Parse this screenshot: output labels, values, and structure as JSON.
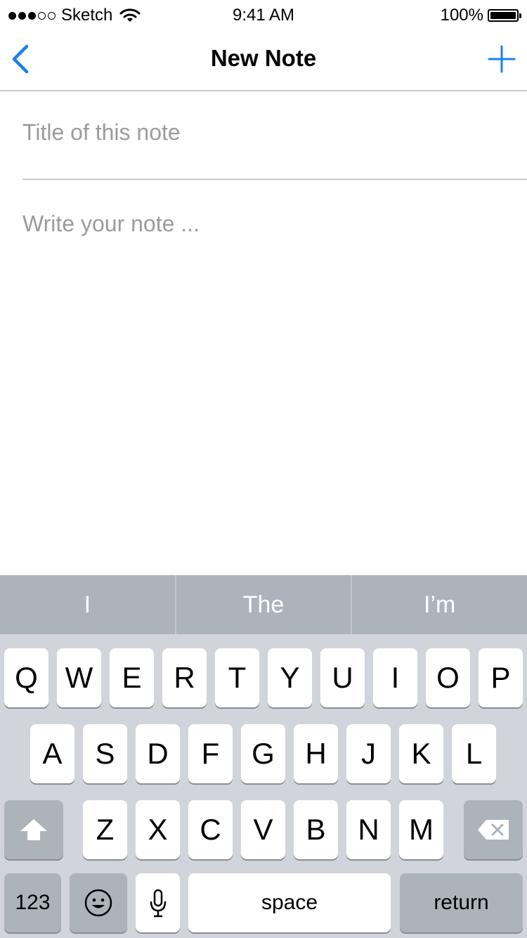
{
  "status_bar": {
    "carrier": "Sketch",
    "time": "9:41 AM",
    "battery": "100%",
    "signal_bars_filled": 3,
    "signal_bars_total": 5
  },
  "nav": {
    "title": "New Note",
    "back_icon": "chevron-left-icon",
    "add_icon": "plus-icon",
    "accent_color": "#1a7ff2"
  },
  "form": {
    "title_placeholder": "Title of this note",
    "title_value": "",
    "note_placeholder": "Write your note ...",
    "note_value": ""
  },
  "keyboard": {
    "suggestions": [
      "I",
      "The",
      "I’m"
    ],
    "row1": [
      "Q",
      "W",
      "E",
      "R",
      "T",
      "Y",
      "U",
      "I",
      "O",
      "P"
    ],
    "row2": [
      "A",
      "S",
      "D",
      "F",
      "G",
      "H",
      "J",
      "K",
      "L"
    ],
    "row3": [
      "Z",
      "X",
      "C",
      "V",
      "B",
      "N",
      "M"
    ],
    "numbers_label": "123",
    "space_label": "space",
    "return_label": "return"
  }
}
